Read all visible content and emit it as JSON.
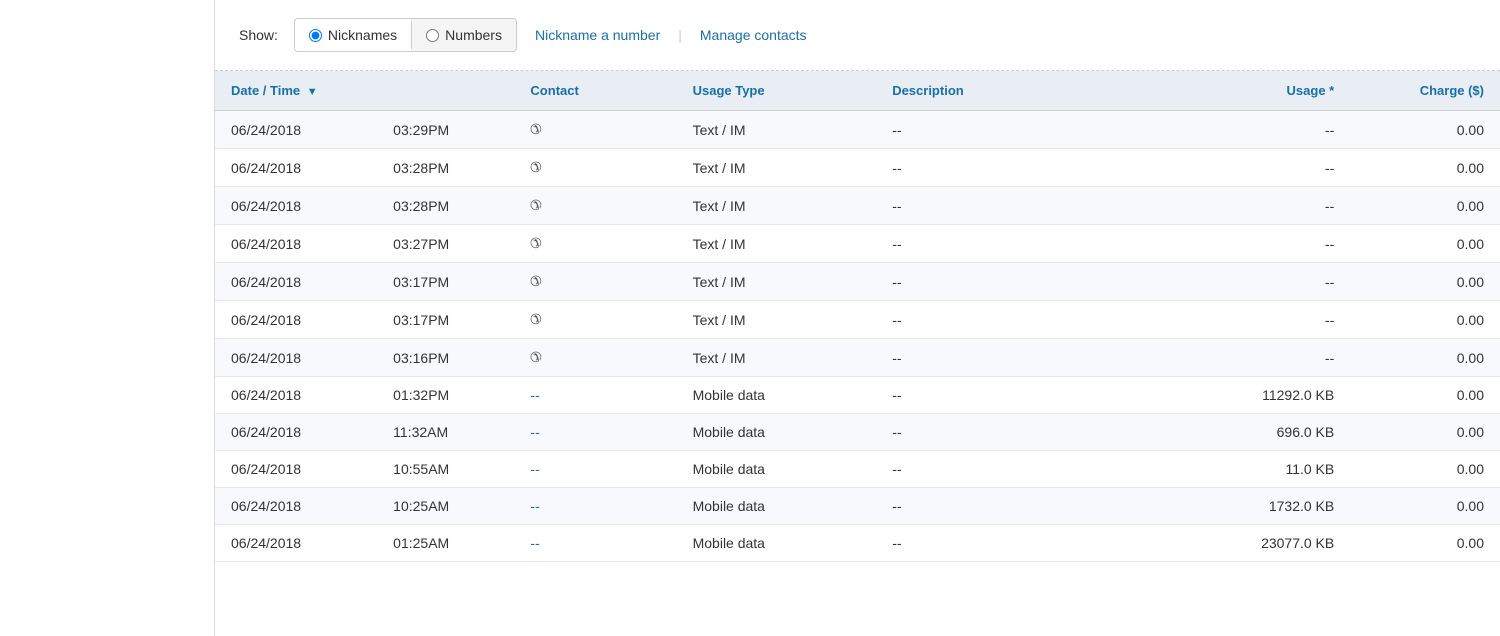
{
  "controls": {
    "show_label": "Show:",
    "radio_nicknames": "Nicknames",
    "radio_numbers": "Numbers",
    "nickname_link": "Nickname a number",
    "manage_link": "Manage contacts"
  },
  "table": {
    "headers": [
      {
        "key": "date_time",
        "label": "Date / Time",
        "sortable": true,
        "align": "left"
      },
      {
        "key": "contact",
        "label": "Contact",
        "align": "left"
      },
      {
        "key": "usage_type",
        "label": "Usage Type",
        "align": "left"
      },
      {
        "key": "description",
        "label": "Description",
        "align": "left"
      },
      {
        "key": "usage",
        "label": "Usage *",
        "align": "right"
      },
      {
        "key": "charge",
        "label": "Charge ($)",
        "align": "right"
      }
    ],
    "rows": [
      {
        "date": "06/24/2018",
        "time": "03:29PM",
        "contact_type": "phone",
        "contact_value": "",
        "usage_type": "Text / IM",
        "description": "--",
        "usage": "--",
        "charge": "0.00"
      },
      {
        "date": "06/24/2018",
        "time": "03:28PM",
        "contact_type": "phone",
        "contact_value": "",
        "usage_type": "Text / IM",
        "description": "--",
        "usage": "--",
        "charge": "0.00"
      },
      {
        "date": "06/24/2018",
        "time": "03:28PM",
        "contact_type": "phone",
        "contact_value": "",
        "usage_type": "Text / IM",
        "description": "--",
        "usage": "--",
        "charge": "0.00"
      },
      {
        "date": "06/24/2018",
        "time": "03:27PM",
        "contact_type": "phone",
        "contact_value": "",
        "usage_type": "Text / IM",
        "description": "--",
        "usage": "--",
        "charge": "0.00"
      },
      {
        "date": "06/24/2018",
        "time": "03:17PM",
        "contact_type": "phone",
        "contact_value": "",
        "usage_type": "Text / IM",
        "description": "--",
        "usage": "--",
        "charge": "0.00"
      },
      {
        "date": "06/24/2018",
        "time": "03:17PM",
        "contact_type": "phone",
        "contact_value": "",
        "usage_type": "Text / IM",
        "description": "--",
        "usage": "--",
        "charge": "0.00"
      },
      {
        "date": "06/24/2018",
        "time": "03:16PM",
        "contact_type": "phone",
        "contact_value": "",
        "usage_type": "Text / IM",
        "description": "--",
        "usage": "--",
        "charge": "0.00"
      },
      {
        "date": "06/24/2018",
        "time": "01:32PM",
        "contact_type": "link",
        "contact_value": "--",
        "usage_type": "Mobile data",
        "description": "--",
        "usage": "11292.0 KB",
        "charge": "0.00"
      },
      {
        "date": "06/24/2018",
        "time": "11:32AM",
        "contact_type": "link",
        "contact_value": "--",
        "usage_type": "Mobile data",
        "description": "--",
        "usage": "696.0 KB",
        "charge": "0.00"
      },
      {
        "date": "06/24/2018",
        "time": "10:55AM",
        "contact_type": "link",
        "contact_value": "--",
        "usage_type": "Mobile data",
        "description": "--",
        "usage": "11.0 KB",
        "charge": "0.00"
      },
      {
        "date": "06/24/2018",
        "time": "10:25AM",
        "contact_type": "link",
        "contact_value": "--",
        "usage_type": "Mobile data",
        "description": "--",
        "usage": "1732.0 KB",
        "charge": "0.00"
      },
      {
        "date": "06/24/2018",
        "time": "01:25AM",
        "contact_type": "link",
        "contact_value": "--",
        "usage_type": "Mobile data",
        "description": "--",
        "usage": "23077.0 KB",
        "charge": "0.00"
      }
    ]
  }
}
